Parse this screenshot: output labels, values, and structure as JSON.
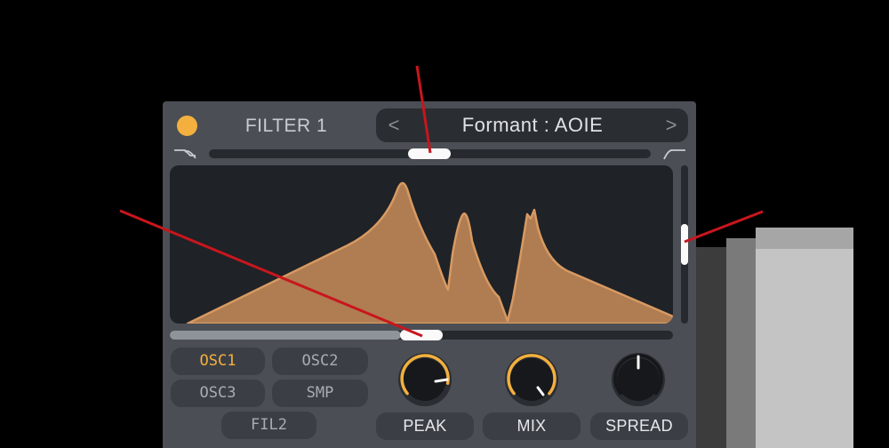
{
  "filter": {
    "title": "FILTER 1",
    "enabled": true,
    "accent_color": "#f3b03e",
    "preset": {
      "prev_label": "<",
      "name": "Formant : AOIE",
      "next_label": ">"
    },
    "icons": {
      "lowpass": "lowpass-curve-icon",
      "highpass": "highpass-curve-icon"
    },
    "cutoff_position": 0.5,
    "horizontal_scroll": 0.5,
    "vertical_scroll": 0.45
  },
  "routing": {
    "buttons": [
      {
        "label": "OSC1",
        "active": true
      },
      {
        "label": "OSC2",
        "active": false
      },
      {
        "label": "OSC3",
        "active": false
      },
      {
        "label": "SMP",
        "active": false
      },
      {
        "label": "FIL2",
        "active": false
      }
    ]
  },
  "knobs": [
    {
      "label": "PEAK",
      "value": 0.6
    },
    {
      "label": "MIX",
      "value": 0.82
    },
    {
      "label": "SPREAD",
      "value": 0.5
    }
  ],
  "colors": {
    "panel": "#4b4f55",
    "display_bg": "#1f2226",
    "curve_fill": "#b07c52",
    "curve_stroke": "#d79a62",
    "annotation": "#c8161d"
  }
}
